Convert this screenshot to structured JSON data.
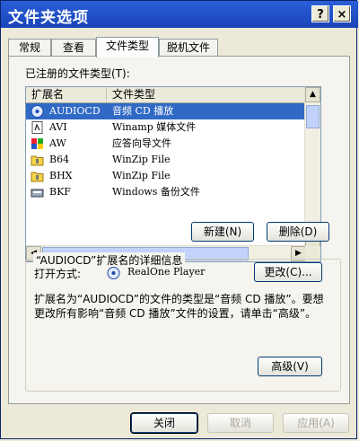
{
  "window": {
    "title": "文件夹选项",
    "help_glyph": "?",
    "close_glyph": "×"
  },
  "tabs": [
    {
      "label": "常规"
    },
    {
      "label": "查看"
    },
    {
      "label": "文件类型",
      "active": true
    },
    {
      "label": "脱机文件"
    }
  ],
  "registered_label": "已注册的文件类型(T):",
  "list": {
    "columns": [
      "扩展名",
      "文件类型"
    ],
    "rows": [
      {
        "ext": "AUDIOCD",
        "type": "音频 CD 播放",
        "icon": "audiocd-icon",
        "selected": true
      },
      {
        "ext": "AVI",
        "type": "Winamp 媒体文件",
        "icon": "media-file-icon"
      },
      {
        "ext": "AW",
        "type": "应答向导文件",
        "icon": "wizard-file-icon"
      },
      {
        "ext": "B64",
        "type": "WinZip File",
        "icon": "winzip-folder-icon"
      },
      {
        "ext": "BHX",
        "type": "WinZip File",
        "icon": "winzip-folder-icon"
      },
      {
        "ext": "BKF",
        "type": "Windows 备份文件",
        "icon": "backup-file-icon"
      }
    ],
    "scroll_up": "▲",
    "scroll_down": "▼",
    "scroll_left": "◀",
    "scroll_right": "▶"
  },
  "buttons": {
    "new": "新建(N)",
    "delete": "删除(D)",
    "change": "更改(C)...",
    "advanced": "高级(V)",
    "close": "关闭",
    "cancel": "取消",
    "apply": "应用(A)"
  },
  "details": {
    "title": "“AUDIOCD”扩展名的详细信息",
    "open_with_label": "打开方式:",
    "open_with_app": "RealOne Player",
    "description": "扩展名为“AUDIOCD”的文件的类型是“音频 CD 播放”。要想更改所有影响“音频 CD 播放”文件的设置，请单击“高级”。"
  },
  "colors": {
    "titlebar": "#1a44b8",
    "selection": "#316ac5",
    "face": "#ece9d8"
  }
}
